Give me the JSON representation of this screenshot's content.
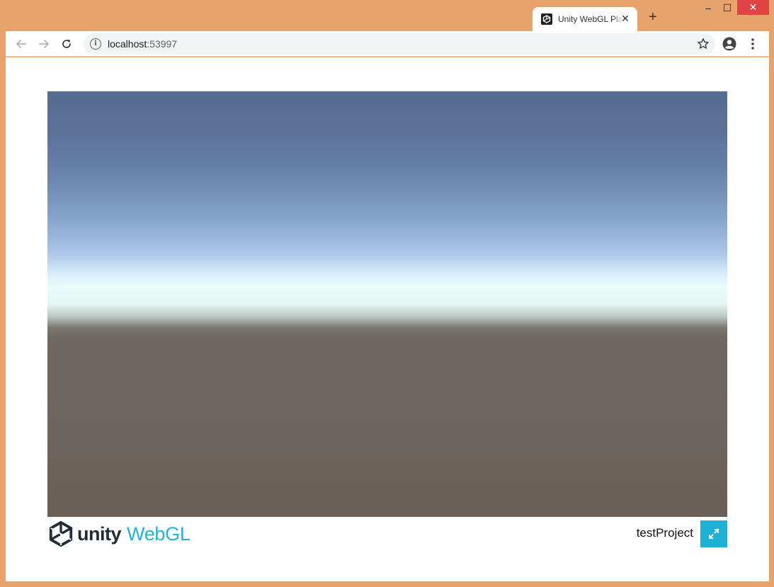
{
  "browser": {
    "tab": {
      "title": "Unity WebGL Player | testProject",
      "favicon": "unity-logo-icon",
      "close_glyph": "✕"
    },
    "new_tab_glyph": "+",
    "window_controls": {
      "minimize_glyph": "–",
      "maximize_glyph": "☐",
      "close_glyph": "✕"
    },
    "address": {
      "host": "localhost",
      "port": ":53997"
    }
  },
  "player": {
    "logo_unity": "unity",
    "logo_webgl": "WebGL",
    "project_title": "testProject"
  },
  "colors": {
    "frame": "#e8a26b",
    "close_button": "#e04343",
    "webgl_accent": "#1fb4d8",
    "fullscreen_button": "#1fb0d8",
    "sky_top": "#566b91",
    "horizon": "#eafcfb",
    "ground": "#6d6560"
  }
}
